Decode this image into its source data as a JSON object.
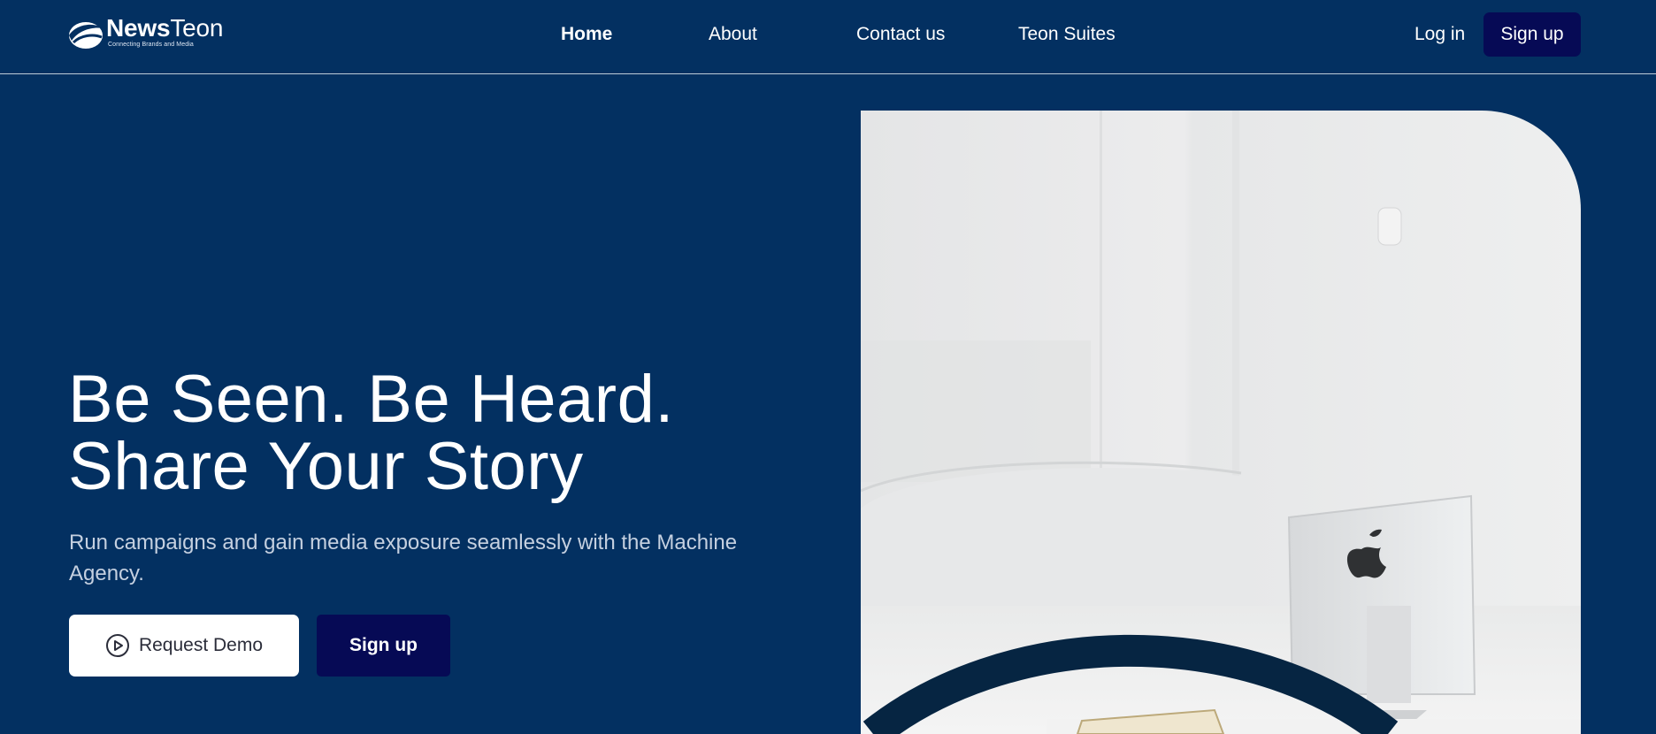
{
  "header": {
    "logo": {
      "brand_bold": "News",
      "brand_light": "Teon",
      "tagline": "Connecting Brands and Media"
    },
    "nav": [
      {
        "label": "Home",
        "active": true
      },
      {
        "label": "About",
        "active": false
      },
      {
        "label": "Contact us",
        "active": false
      },
      {
        "label": "Teon Suites",
        "active": false
      }
    ],
    "login_label": "Log in",
    "signup_label": "Sign up"
  },
  "hero": {
    "title_line1": "Be Seen. Be Heard.",
    "title_line2": "Share Your Story",
    "subtitle": "Run campaigns and gain media exposure seamlessly with the Machine Agency.",
    "demo_button": {
      "label": "Request Demo",
      "icon": "play-circle-icon"
    },
    "signup_button": {
      "label": "Sign up"
    },
    "image": {
      "subject": "bright white office with desktop computer",
      "overlay": "dark navy arc"
    }
  },
  "colors": {
    "background": "#033061",
    "button_dark": "#060a55",
    "button_light": "#ffffff",
    "arc": "#062542",
    "subtitle_text": "#c5d0e0"
  }
}
